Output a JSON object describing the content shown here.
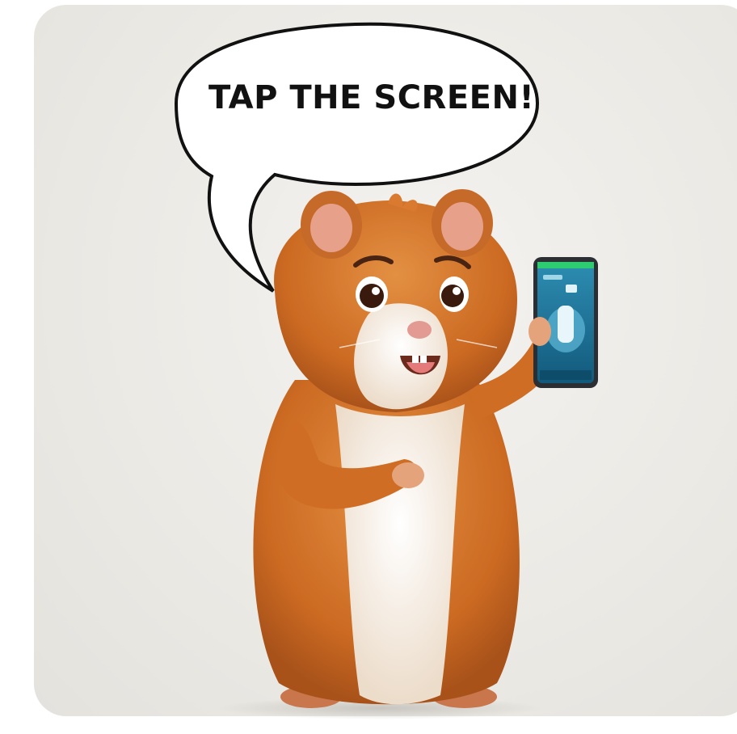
{
  "image": {
    "kind": "illustration",
    "subject": "hamster",
    "speech_bubble": {
      "text": "TAP THE SCREEN!"
    },
    "phone": {
      "screen_color": "#1d6f8e",
      "frame_color": "#2b2f33",
      "accent": "#2ecc71"
    },
    "colors": {
      "background": "#ece9e4",
      "fur_orange": "#cc6a22",
      "fur_cream": "#f5ebe0",
      "ear_inner": "#e7a08a",
      "nose": "#e39a93"
    }
  }
}
